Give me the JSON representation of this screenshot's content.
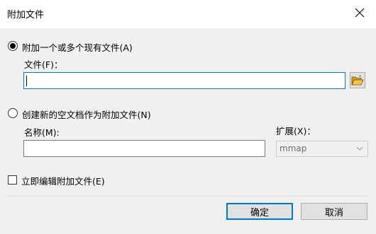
{
  "dialog": {
    "title": "附加文件",
    "close_glyph": "✕"
  },
  "option_existing": {
    "label": "附加一个或多个现有文件(A)",
    "checked": true,
    "file_label": "文件(F)：",
    "file_value": ""
  },
  "option_new": {
    "label": "创建新的空文档作为附加文件(N)",
    "checked": false,
    "name_label": "名称(M):",
    "name_value": "",
    "ext_label": "扩展(X)：",
    "ext_value": "mmap"
  },
  "edit_immediately": {
    "label": "立即编辑附加文件(E)",
    "checked": false
  },
  "buttons": {
    "ok": "确定",
    "cancel": "取消"
  },
  "colors": {
    "accent": "#0078d7",
    "folder_icon": "#e8b838"
  }
}
